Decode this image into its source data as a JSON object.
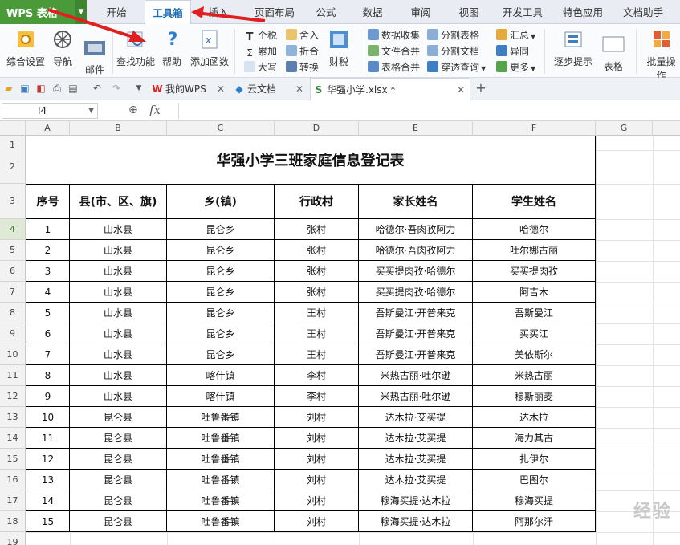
{
  "app": {
    "name": "WPS 表格"
  },
  "ribbon_tabs": [
    "开始",
    "工具箱",
    "插入",
    "页面布局",
    "公式",
    "数据",
    "审阅",
    "视图",
    "开发工具",
    "特色应用",
    "文档助手"
  ],
  "active_tab": "工具箱",
  "ribbon": {
    "big": [
      "综合设置",
      "导航",
      "邮件",
      "查找功能",
      "帮助",
      "添加函数"
    ],
    "small_col1": [
      "个税",
      "累加",
      "大写"
    ],
    "small_col2": [
      "舍入",
      "折合",
      "转换"
    ],
    "caishui": "财税",
    "small_col3": [
      "数据收集",
      "文件合并",
      "表格合并"
    ],
    "small_col4": [
      "分割表格",
      "分割文档",
      "穿透查询"
    ],
    "small_col5": [
      "汇总",
      "异同",
      "更多"
    ],
    "step": "逐步提示",
    "table": "表格",
    "batch": "批量操作"
  },
  "doc_tabs": [
    {
      "label": "我的WPS"
    },
    {
      "label": "云文档"
    },
    {
      "label": "华强小学.xlsx *"
    }
  ],
  "formula_bar": {
    "cell_ref": "I4",
    "fx": "fx",
    "value": ""
  },
  "columns": [
    "A",
    "B",
    "C",
    "D",
    "E",
    "F",
    "G"
  ],
  "rows": [
    "1",
    "2",
    "3",
    "4",
    "5",
    "6",
    "7",
    "8",
    "9",
    "10",
    "11",
    "12",
    "13",
    "14",
    "15",
    "16",
    "17",
    "18",
    "19"
  ],
  "sheet": {
    "title": "华强小学三班家庭信息登记表",
    "headers": [
      "序号",
      "县(市、区、旗)",
      "乡(镇)",
      "行政村",
      "家长姓名",
      "学生姓名"
    ],
    "records": [
      [
        "1",
        "山水县",
        "昆仑乡",
        "张村",
        "哈德尔·吾肉孜阿力",
        "哈德尔"
      ],
      [
        "2",
        "山水县",
        "昆仑乡",
        "张村",
        "哈德尔·吾肉孜阿力",
        "吐尔娜古丽"
      ],
      [
        "3",
        "山水县",
        "昆仑乡",
        "张村",
        "买买提肉孜·哈德尔",
        "买买提肉孜"
      ],
      [
        "4",
        "山水县",
        "昆仑乡",
        "张村",
        "买买提肉孜·哈德尔",
        "阿吉木"
      ],
      [
        "5",
        "山水县",
        "昆仑乡",
        "王村",
        "吾斯曼江·开普来克",
        "吾斯曼江"
      ],
      [
        "6",
        "山水县",
        "昆仑乡",
        "王村",
        "吾斯曼江·开普来克",
        "买买江"
      ],
      [
        "7",
        "山水县",
        "昆仑乡",
        "王村",
        "吾斯曼江·开普来克",
        "美依斯尔"
      ],
      [
        "8",
        "山水县",
        "喀什镇",
        "李村",
        "米热古丽·吐尔逊",
        "米热古丽"
      ],
      [
        "9",
        "山水县",
        "喀什镇",
        "李村",
        "米热古丽·吐尔逊",
        "穆斯丽麦"
      ],
      [
        "10",
        "昆仑县",
        "吐鲁番镇",
        "刘村",
        "达木拉·艾买提",
        "达木拉"
      ],
      [
        "11",
        "昆仑县",
        "吐鲁番镇",
        "刘村",
        "达木拉·艾买提",
        "海力其古"
      ],
      [
        "12",
        "昆仑县",
        "吐鲁番镇",
        "刘村",
        "达木拉·艾买提",
        "扎伊尔"
      ],
      [
        "13",
        "昆仑县",
        "吐鲁番镇",
        "刘村",
        "达木拉·艾买提",
        "巴图尔"
      ],
      [
        "14",
        "昆仑县",
        "吐鲁番镇",
        "刘村",
        "穆海买提·达木拉",
        "穆海买提"
      ],
      [
        "15",
        "昆仑县",
        "吐鲁番镇",
        "刘村",
        "穆海买提·达木拉",
        "阿那尔汗"
      ]
    ]
  },
  "watermark": "经验",
  "colors": {
    "accent": "#4a9a3a",
    "link_blue": "#1d6fb8",
    "arrow_red": "#e02020"
  }
}
